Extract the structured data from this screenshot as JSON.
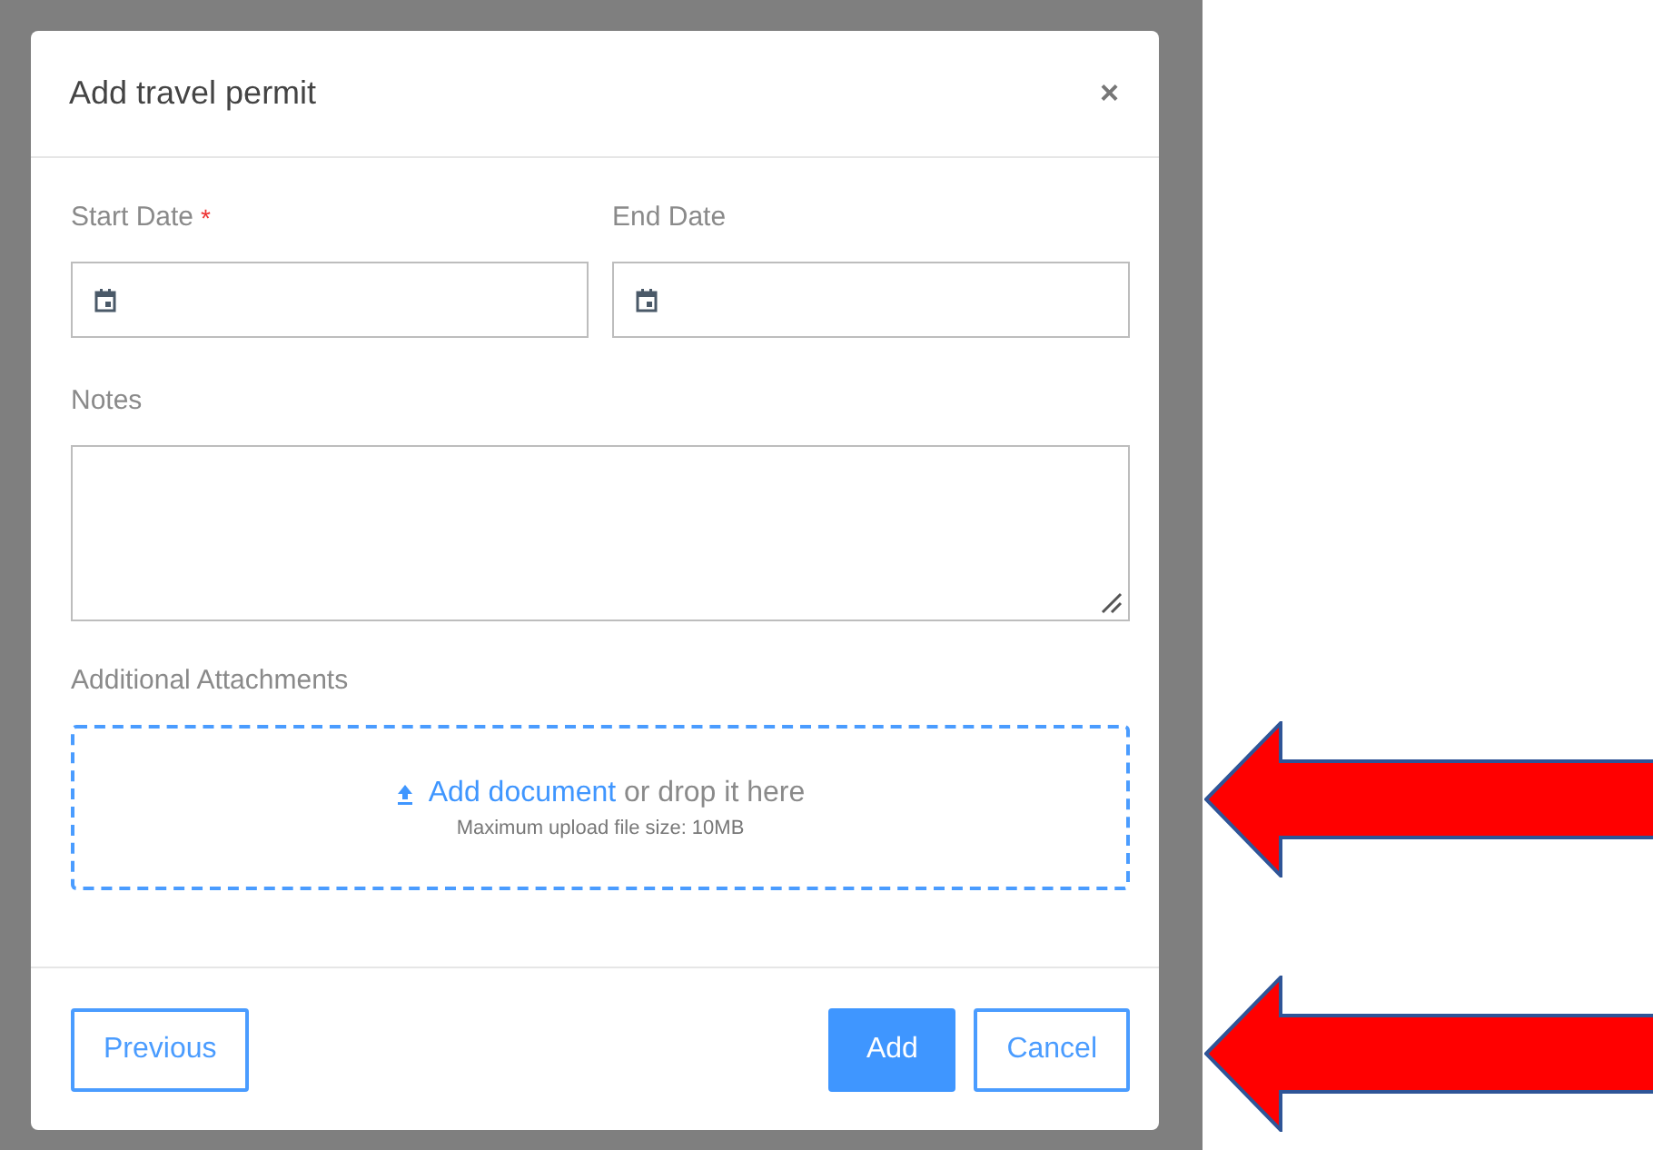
{
  "dialog": {
    "title": "Add travel permit",
    "close": "×"
  },
  "date_fields": [
    {
      "label": "Start Date",
      "required_mark": "*"
    },
    {
      "label": "End Date"
    }
  ],
  "notes": {
    "label": "Notes"
  },
  "attachments": {
    "label": "Additional Attachments",
    "link": "Add document",
    "text": " or drop it here",
    "hint": "Maximum upload file size: 10MB"
  },
  "footer_left": [
    {
      "label": "Previous",
      "kind": "outline"
    }
  ],
  "footer_right": [
    {
      "label": "Add",
      "kind": "primary"
    },
    {
      "label": "Cancel",
      "kind": "outline"
    }
  ]
}
